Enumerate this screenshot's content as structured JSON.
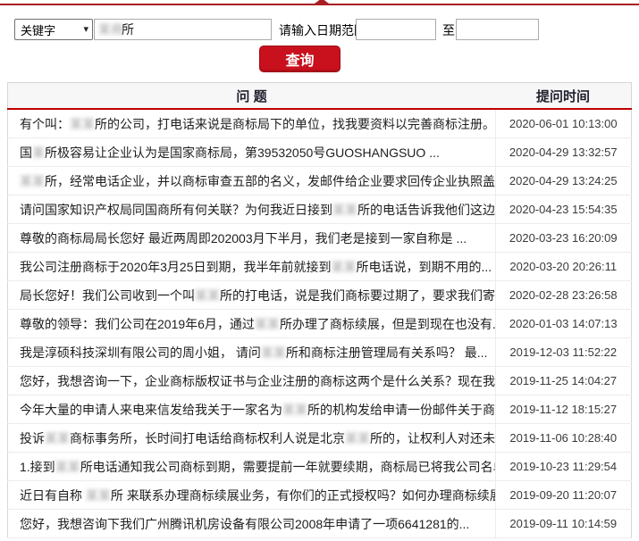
{
  "colors": {
    "accent_red": "#c8111d",
    "top_rule_red": "#a91e23",
    "header_underline_red": "#c00000"
  },
  "icons": {
    "chevron_down": "▾"
  },
  "form": {
    "select_value": "关键字",
    "keyword_blur": "某商",
    "keyword_visible": "所",
    "date_label": "请输入日期范围",
    "date_from_value": "",
    "date_to_value": "",
    "to_label": "至",
    "search_button": "查询"
  },
  "table": {
    "header_question": "问 题",
    "header_time": "提问时间",
    "rows": [
      {
        "q": [
          {
            "t": "有个叫："
          },
          {
            "t": "某某",
            "blur": true
          },
          {
            "t": "所的公司，打电话来说是商标局下的单位，找我要资料以完善商标注册。但我..."
          }
        ],
        "time": "2020-06-01 10:13:00"
      },
      {
        "q": [
          {
            "t": "国"
          },
          {
            "t": "某",
            "blur": true
          },
          {
            "t": "所极容易让企业认为是国家商标局，第39532050号GUOSHANGSUO ..."
          }
        ],
        "time": "2020-04-29 13:32:57"
      },
      {
        "q": [
          {
            "t": "某某",
            "blur": true
          },
          {
            "t": "所，经常电话企业，并以商标审查五部的名义，发邮件给企业要求回传企业执照盖章扫..."
          }
        ],
        "time": "2020-04-29 13:24:25"
      },
      {
        "q": [
          {
            "t": "请问国家知识产权局同国商所有何关联？为何我近日接到"
          },
          {
            "t": "某某",
            "blur": true
          },
          {
            "t": "所的电话告诉我他们这边是知..."
          }
        ],
        "time": "2020-04-23 15:54:35"
      },
      {
        "q": [
          {
            "t": "尊敬的商标局局长您好 最近两周即202003月下半月，我们老是接到一家自称是 ..."
          }
        ],
        "time": "2020-03-23 16:20:09"
      },
      {
        "q": [
          {
            "t": "我公司注册商标于2020年3月25日到期，我半年前就接到"
          },
          {
            "t": "某某",
            "blur": true
          },
          {
            "t": "所电话说，到期不用的..."
          }
        ],
        "time": "2020-03-20 20:26:11"
      },
      {
        "q": [
          {
            "t": "局长您好！我们公司收到一个叫"
          },
          {
            "t": "某某",
            "blur": true
          },
          {
            "t": "所的打电话，说是我们商标要过期了，要求我们寄资料..."
          }
        ],
        "time": "2020-02-28 23:26:58"
      },
      {
        "q": [
          {
            "t": "尊敬的领导：我们公司在2019年6月，通过"
          },
          {
            "t": "某某",
            "blur": true
          },
          {
            "t": "所办理了商标续展，但是到现在也没有..."
          }
        ],
        "time": "2020-01-03 14:07:13"
      },
      {
        "q": [
          {
            "t": "我是淳硕科技深圳有限公司的周小姐， 请问"
          },
          {
            "t": "某某",
            "blur": true
          },
          {
            "t": "所和商标注册管理局有关系吗？ 最..."
          }
        ],
        "time": "2019-12-03 11:52:22"
      },
      {
        "q": [
          {
            "t": "您好，我想咨询一下，企业商标版权证书与企业注册的商标这两个是什么关系？现在我企业..."
          }
        ],
        "time": "2019-11-25 14:04:27"
      },
      {
        "q": [
          {
            "t": "今年大量的申请人来电来信发给我关于一家名为"
          },
          {
            "t": "某某",
            "blur": true
          },
          {
            "t": "所的机构发给申请一份邮件关于商标续..."
          }
        ],
        "time": "2019-11-12 18:15:27"
      },
      {
        "q": [
          {
            "t": "投诉"
          },
          {
            "t": "某某",
            "blur": true
          },
          {
            "t": "商标事务所，长时间打电话给商标权利人说是北京"
          },
          {
            "t": "某某",
            "blur": true
          },
          {
            "t": "所的，让权利人对还未到续..."
          }
        ],
        "time": "2019-11-06 10:28:40"
      },
      {
        "q": [
          {
            "t": "1.接到"
          },
          {
            "t": "某某",
            "blur": true
          },
          {
            "t": "所电话通知我公司商标到期，需要提前一年就要续期，商标局已将我公司名单..."
          }
        ],
        "time": "2019-10-23 11:29:54"
      },
      {
        "q": [
          {
            "t": "近日有自称 "
          },
          {
            "t": "某某",
            "blur": true
          },
          {
            "t": "所 来联系办理商标续展业务，有你们的正式授权吗？如何办理商标续展..."
          }
        ],
        "time": "2019-09-20 11:20:07"
      },
      {
        "q": [
          {
            "t": "您好，我想咨询下我们广州腾讯机房设备有限公司2008年申请了一项6641281的..."
          }
        ],
        "time": "2019-09-11 10:14:59"
      }
    ]
  }
}
